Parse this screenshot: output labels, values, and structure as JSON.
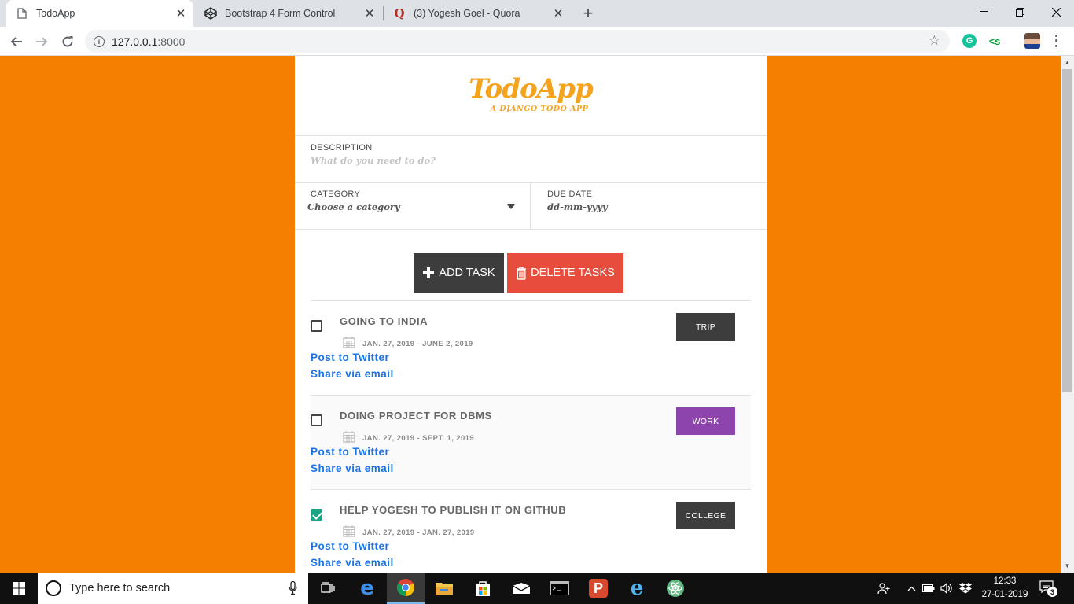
{
  "browser": {
    "tabs": [
      {
        "title": "TodoApp",
        "active": true
      },
      {
        "title": "Bootstrap 4 Form Control",
        "active": false
      },
      {
        "title": "(3) Yogesh Goel - Quora",
        "active": false
      }
    ],
    "url_host": "127.0.0.1",
    "url_port": ":8000"
  },
  "app": {
    "logo": "TodoApp",
    "subtitle": "A DJANGO TODO APP",
    "description_label": "DESCRIPTION",
    "description_placeholder": "What do you need to do?",
    "category_label": "CATEGORY",
    "category_value": "Choose a category",
    "due_label": "DUE DATE",
    "due_placeholder": "dd-mm-yyyy",
    "add_button": "ADD TASK",
    "delete_button": "DELETE TASKS"
  },
  "tasks": [
    {
      "name": "GOING TO INDIA",
      "dates": "JAN. 27, 2019 - JUNE 2, 2019",
      "category": "TRIP",
      "tag_color": "#3d3d3d",
      "done": false,
      "twitter": "Post to Twitter",
      "email": "Share via email"
    },
    {
      "name": "DOING PROJECT FOR DBMS",
      "dates": "JAN. 27, 2019 - SEPT. 1, 2019",
      "category": "WORK",
      "tag_color": "#8e44ad",
      "done": false,
      "twitter": "Post to Twitter",
      "email": "Share via email"
    },
    {
      "name": "HELP YOGESH TO PUBLISH IT ON GITHUB",
      "dates": "JAN. 27, 2019 - JAN. 27, 2019",
      "category": "COLLEGE",
      "tag_color": "#3d3d3d",
      "done": true,
      "twitter": "Post to Twitter",
      "email": "Share via email"
    }
  ],
  "taskbar": {
    "search_placeholder": "Type here to search",
    "time": "12:33",
    "date": "27-01-2019",
    "notifications": "3"
  },
  "colors": {
    "page_background": "#f57f00",
    "logo": "#f5a21c",
    "delete_button": "#e74c3c",
    "add_button": "#3d3d3d",
    "link": "#1a73e8",
    "check_done": "#1aa385"
  }
}
